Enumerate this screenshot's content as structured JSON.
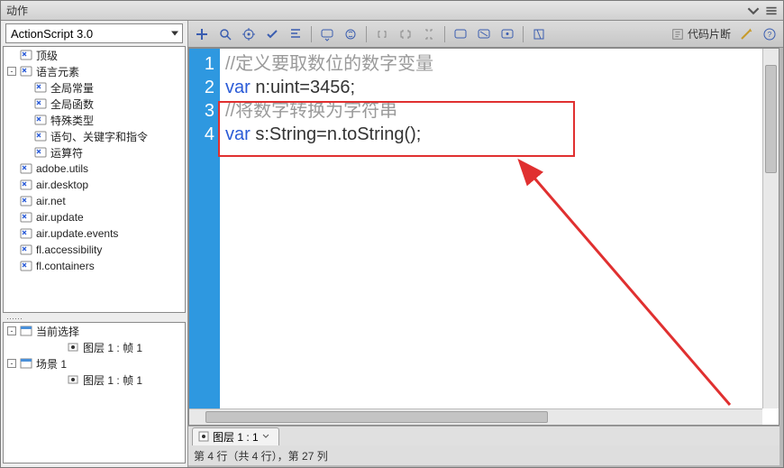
{
  "title": "动作",
  "combo_label": "ActionScript 3.0",
  "tree_top": [
    {
      "depth": 0,
      "twist": "",
      "icon": "pkg",
      "label": "顶级"
    },
    {
      "depth": 0,
      "twist": "-",
      "icon": "pkg",
      "label": "语言元素"
    },
    {
      "depth": 1,
      "twist": "",
      "icon": "pkg",
      "label": "全局常量"
    },
    {
      "depth": 1,
      "twist": "",
      "icon": "pkg",
      "label": "全局函数"
    },
    {
      "depth": 1,
      "twist": "",
      "icon": "pkg",
      "label": "特殊类型"
    },
    {
      "depth": 1,
      "twist": "",
      "icon": "pkg",
      "label": "语句、关键字和指令"
    },
    {
      "depth": 1,
      "twist": "",
      "icon": "pkg",
      "label": "运算符"
    },
    {
      "depth": 0,
      "twist": "",
      "icon": "pkg",
      "label": "adobe.utils"
    },
    {
      "depth": 0,
      "twist": "",
      "icon": "pkg",
      "label": "air.desktop"
    },
    {
      "depth": 0,
      "twist": "",
      "icon": "pkg",
      "label": "air.net"
    },
    {
      "depth": 0,
      "twist": "",
      "icon": "pkg",
      "label": "air.update"
    },
    {
      "depth": 0,
      "twist": "",
      "icon": "pkg",
      "label": "air.update.events"
    },
    {
      "depth": 0,
      "twist": "",
      "icon": "pkg",
      "label": "fl.accessibility"
    },
    {
      "depth": 0,
      "twist": "",
      "icon": "pkg",
      "label": "fl.containers"
    }
  ],
  "tree_bottom": [
    {
      "depth": 0,
      "twist": "-",
      "icon": "scene",
      "label": "当前选择"
    },
    {
      "depth": 2,
      "twist": "",
      "icon": "frame",
      "label": "图层 1 : 帧 1"
    },
    {
      "depth": 0,
      "twist": "-",
      "icon": "scene",
      "label": "场景 1"
    },
    {
      "depth": 2,
      "twist": "",
      "icon": "frame",
      "label": "图层 1 : 帧 1"
    }
  ],
  "code_lines": [
    {
      "n": "1",
      "html": "<span class='com'>//定义要取数位的数字变量</span>"
    },
    {
      "n": "2",
      "html": "<span class='kw'>var</span> n:uint=3456;"
    },
    {
      "n": "3",
      "html": "<span class='com'>//将数字转换为字符串</span>"
    },
    {
      "n": "4",
      "html": "<span class='kw'>var</span> s:String=n.toString();"
    }
  ],
  "snippet_label": "代码片断",
  "tab_label": "图层 1 : 1",
  "status_text": "第 4 行（共 4 行），第 27 列"
}
